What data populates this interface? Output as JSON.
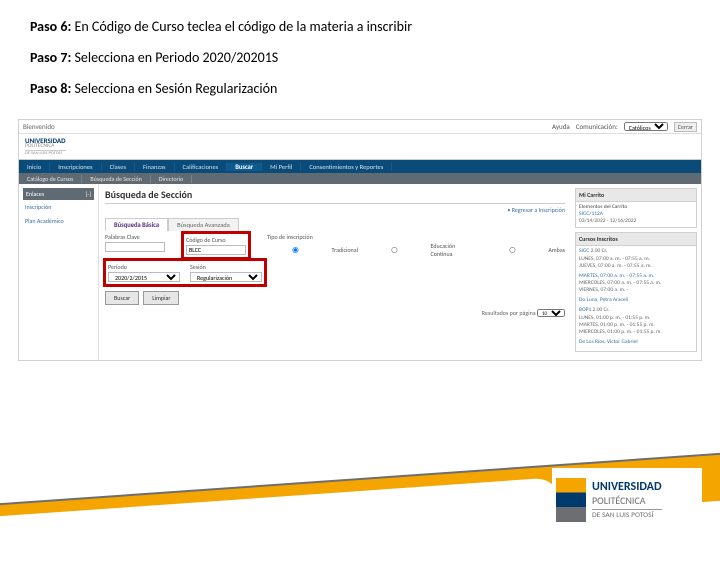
{
  "instructions": {
    "step6": {
      "label": "Paso 6:",
      "text": " En Código de Curso teclea el código de la materia a inscribir"
    },
    "step7": {
      "label": "Paso 7:",
      "text": " Selecciona en Periodo 2020/20201S"
    },
    "step8": {
      "label": "Paso 8:",
      "text": " Selecciona en Sesión Regularización"
    }
  },
  "topbar": {
    "welcome": "Bienvenido",
    "help": "Ayuda",
    "contact": "Comunicación:",
    "contact_value": "Católicos",
    "logout": "Cerrar"
  },
  "brand": {
    "line1": "UNIVERSIDAD",
    "line2": "POLITÉCNICA",
    "line3": "DE SAN LUIS POTOSÍ"
  },
  "navbar": {
    "items": [
      {
        "label": "Inicio"
      },
      {
        "label": "Inscripciones"
      },
      {
        "label": "Clases"
      },
      {
        "label": "Finanzas"
      },
      {
        "label": "Calificaciones"
      },
      {
        "label": "Buscar",
        "active": true
      },
      {
        "label": "Mi Perfil"
      },
      {
        "label": "Consentimientos y Reportes"
      }
    ]
  },
  "subnav": {
    "items": [
      {
        "label": "Catálogo de Cursos"
      },
      {
        "label": "Búsqueda de Sección"
      },
      {
        "label": "Directorio"
      }
    ]
  },
  "sidebar": {
    "head": "Enlaces",
    "toggle": "[-]",
    "links": [
      {
        "label": "Inscripción"
      },
      {
        "label": "Plan Académico"
      }
    ]
  },
  "main": {
    "title": "Búsqueda de Sección",
    "backlink": "• Regresar a Inscripción",
    "tabs": [
      {
        "label": "Búsqueda Básica",
        "active": true
      },
      {
        "label": "Búsqueda Avanzada"
      }
    ],
    "fields": {
      "keywords_label": "Palabras Clave",
      "keywords_value": "",
      "course_code_label": "Código de Curso",
      "course_code_value": "BLCC",
      "enroll_type_label": "Tipo de inscripción",
      "enroll_opts": [
        "Tradicional",
        "Educación Continua",
        "Ambas"
      ],
      "period_label": "Período",
      "period_value": "2020/2/2015",
      "session_label": "Sesión",
      "session_value": "Regularización"
    },
    "buttons": {
      "search": "Buscar",
      "clear": "Limpiar"
    },
    "results_label": "Resultados por página",
    "results_value": "10"
  },
  "rightcol": {
    "cart": {
      "head": "Mi Carrito",
      "line1": "Elementos del Carrito",
      "line2": "SIGC/112A",
      "line3": "03/14/2022 - 12/16/2022"
    },
    "courses": {
      "head": "Cursos Inscritos",
      "items": [
        {
          "code": "SIGC",
          "credits": "2.00 Cr.",
          "sched": "LUNES, 07:00 a. m. - 07:55 a. m.\nJUEVES, 07:00 a. m. - 07:55 a. m."
        },
        {
          "code": "MARTES, 07:00 a. m. - 07:55 a. m.",
          "sched": "MIERCOLES, 07:00 a. m. - 07:55 a. m.\nVIERNES, 07:00 a. m. -"
        },
        {
          "code": "Do Luna, Petra Araceli",
          "credits": ""
        },
        {
          "code": "BOP1",
          "credits": "2.00 Cr.",
          "sched": "LUNES, 01:00 p. m. - 01:55 p. m.\nMARTES, 01:00 p. m. - 01:55 p. m.\nMIERCOLES, 01:00 p. m. - 01:55 p. m."
        },
        {
          "code": "De Los Ríos, Victor Gabriel",
          "credits": ""
        }
      ]
    }
  }
}
